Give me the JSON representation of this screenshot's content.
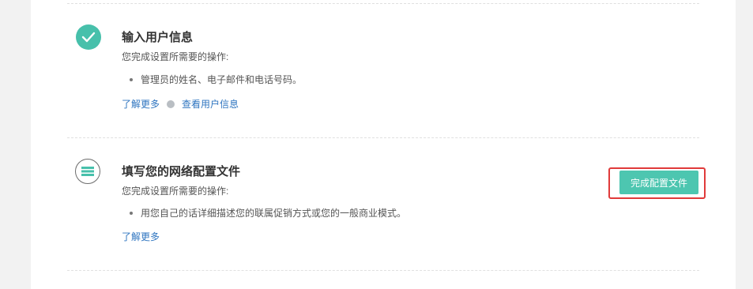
{
  "steps": [
    {
      "title": "输入用户信息",
      "subtitle": "您完成设置所需要的操作:",
      "bullets": [
        "管理员的姓名、电子邮件和电话号码。"
      ],
      "links": [
        "了解更多",
        "查看用户信息"
      ],
      "icon": "check-circle-icon",
      "status": "completed"
    },
    {
      "title": "填写您的网络配置文件",
      "subtitle": "您完成设置所需要的操作:",
      "bullets": [
        "用您自己的话详细描述您的联属促销方式或您的一般商业模式。"
      ],
      "links": [
        "了解更多"
      ],
      "icon": "profile-card-icon",
      "status": "pending",
      "action_label": "完成配置文件"
    }
  ],
  "colors": {
    "accent": "#4dc6b0",
    "check": "#47c0ab",
    "link": "#2f75c0",
    "highlight": "#e03a3a"
  }
}
